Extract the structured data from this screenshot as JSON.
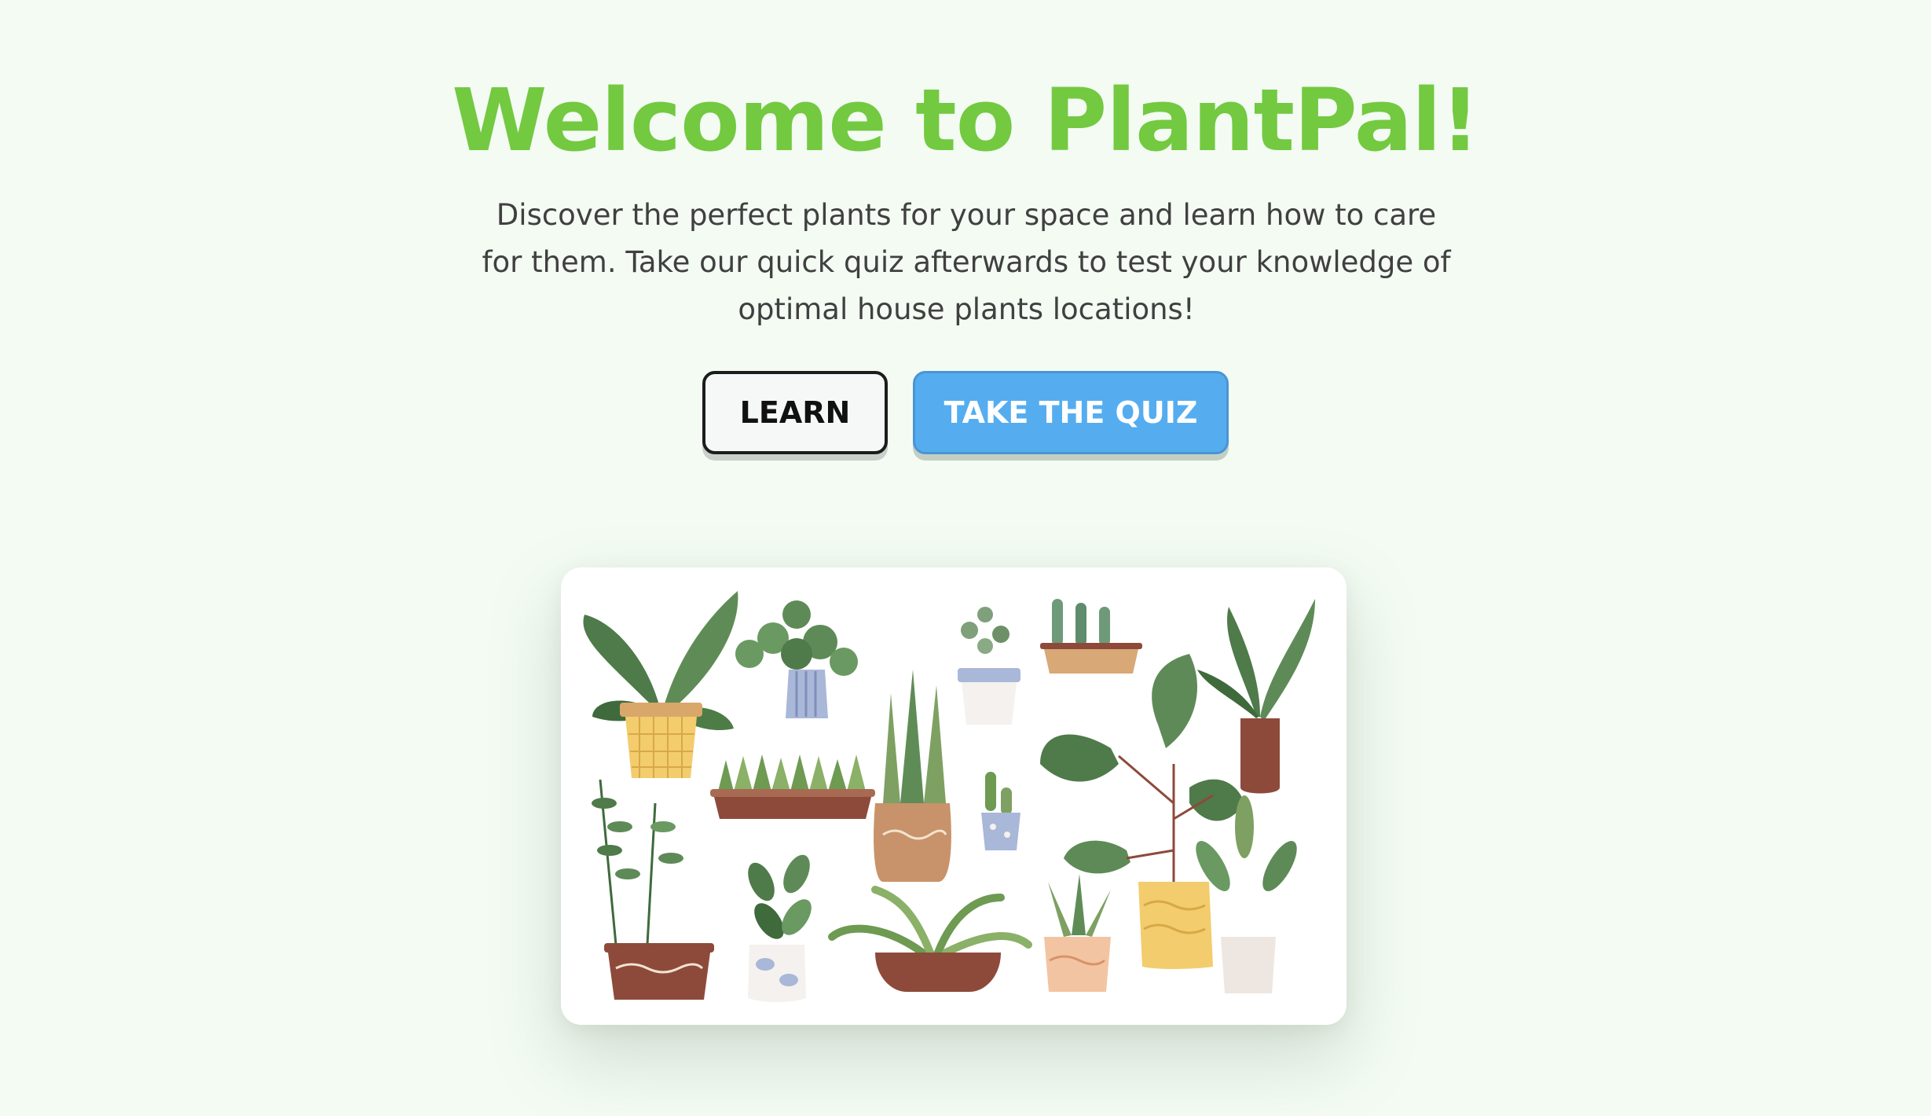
{
  "hero": {
    "title": "Welcome to PlantPal!",
    "subtitle": "Discover the perfect plants for your space and learn how to care for them. Take our quick quiz afterwards to test your knowledge of optimal house plants locations!"
  },
  "actions": {
    "learn_label": "LEARN",
    "quiz_label": "TAKE THE QUIZ"
  },
  "illustration": {
    "icon": "houseplants-illustration"
  },
  "colors": {
    "background": "#f3fbf3",
    "title": "#73c940",
    "quiz_button": "#55adf0"
  }
}
